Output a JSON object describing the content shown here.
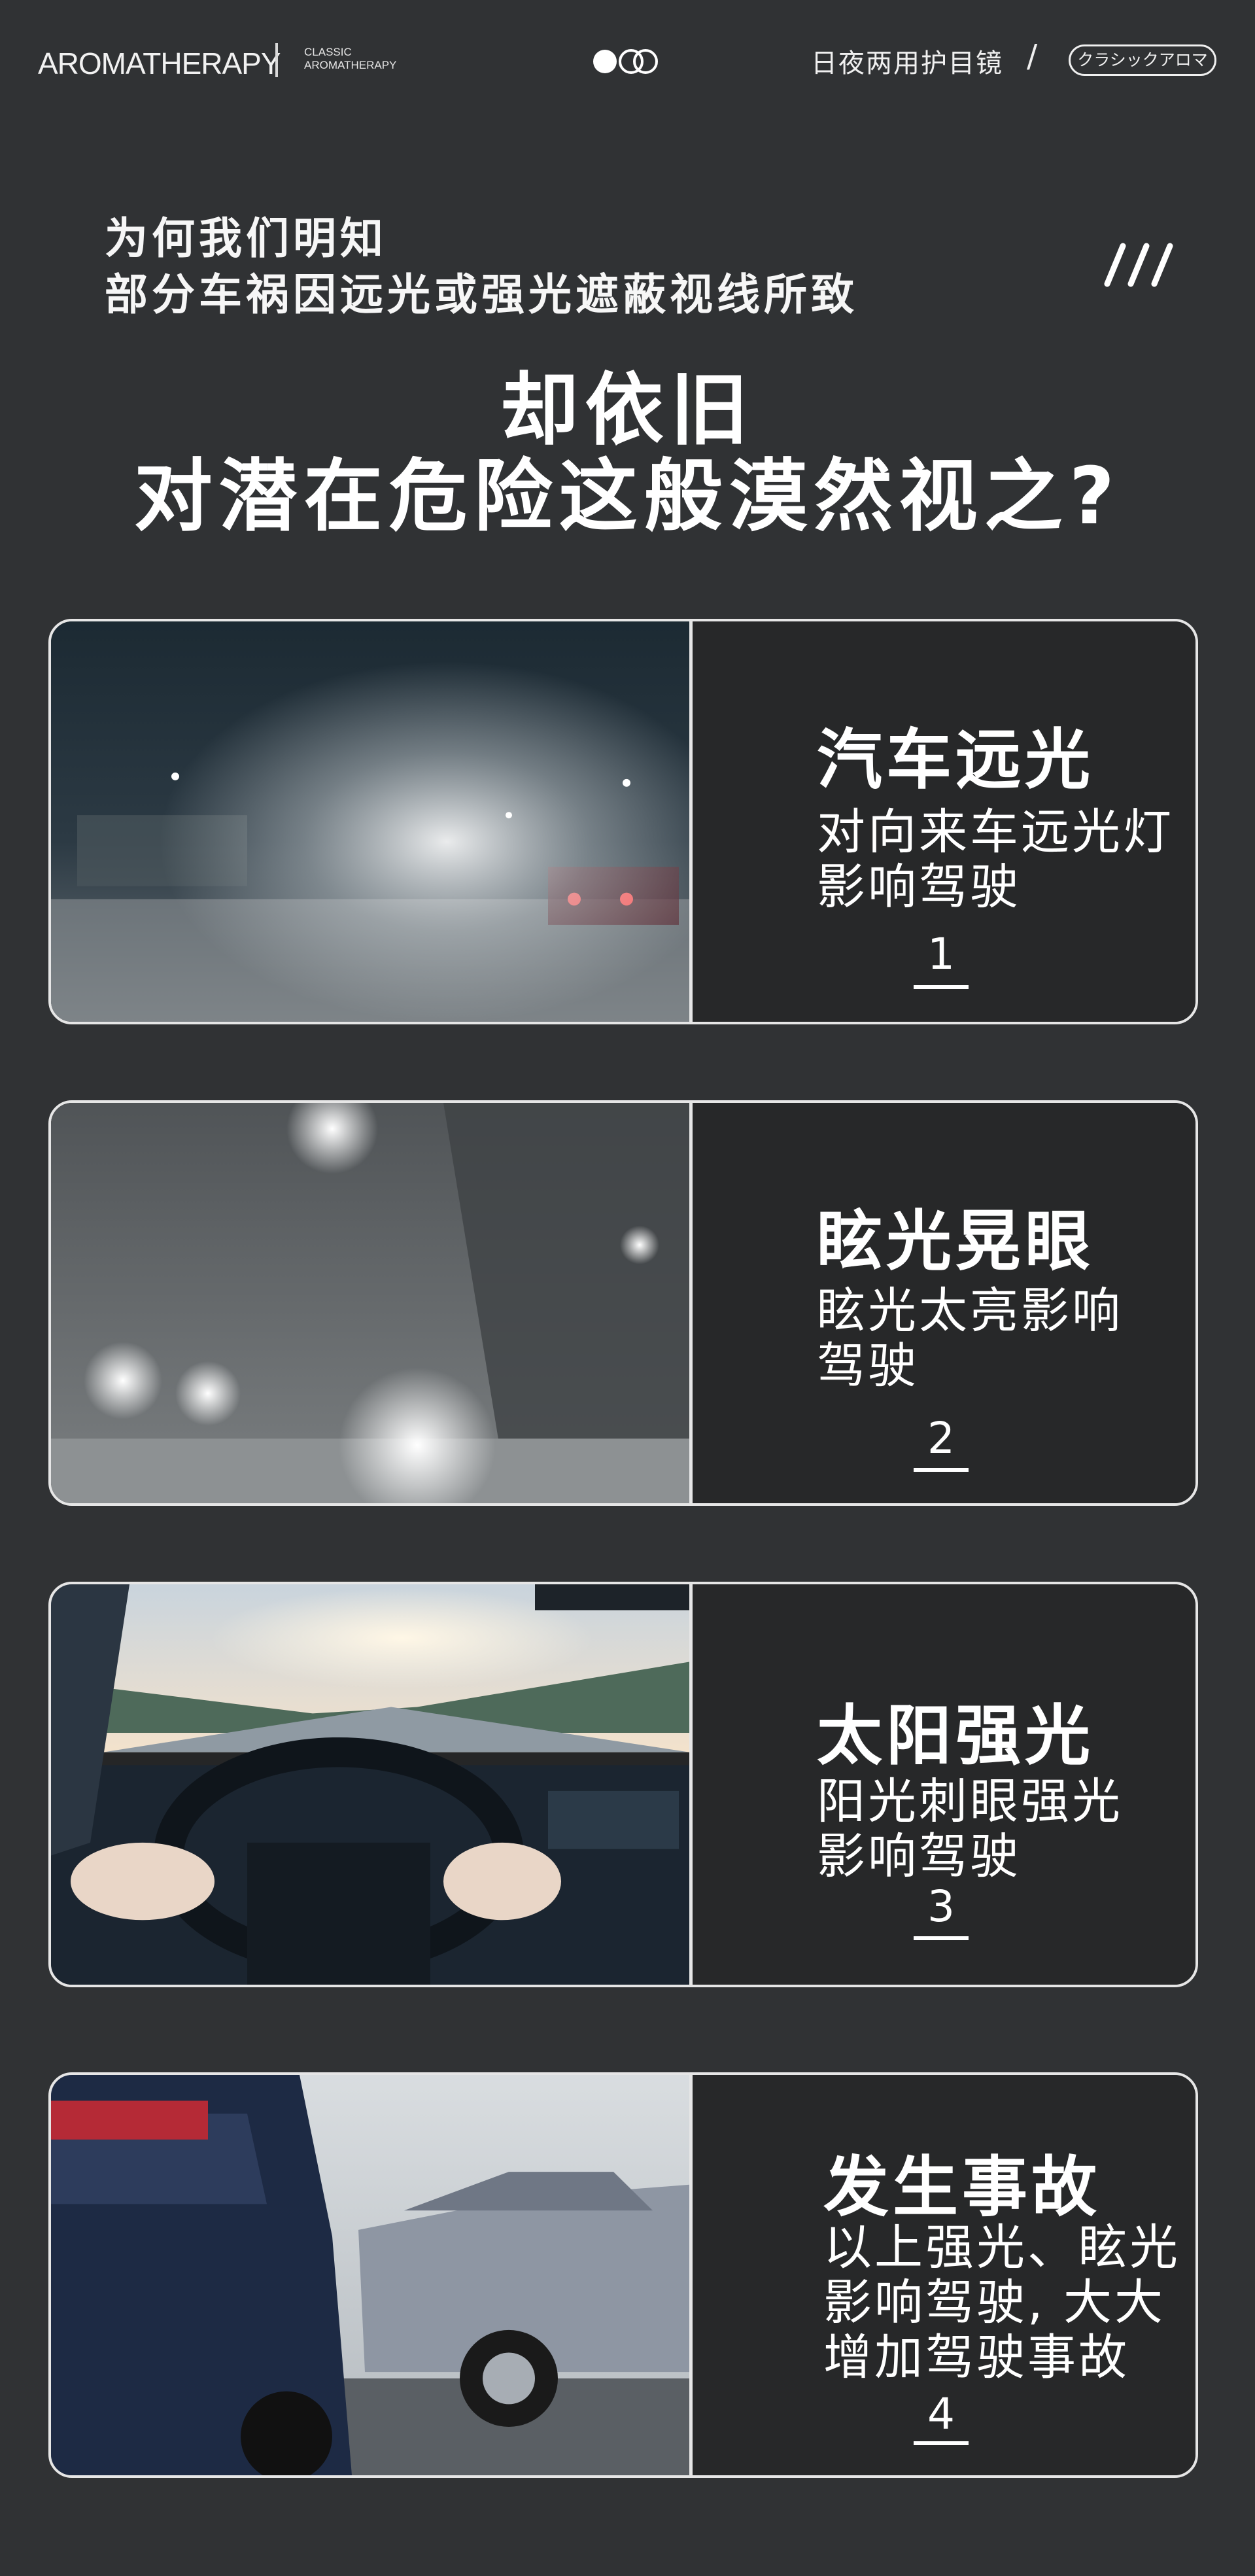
{
  "header": {
    "brand": "AROMATHERAPY",
    "brand_sub_1": "CLASSIC",
    "brand_sub_2": "AROMATHERAPY",
    "nav_text": "日夜两用护目镜",
    "nav_slash": "/",
    "nav_pill": "クラシックアロマ"
  },
  "intro": {
    "line1": "为何我们明知",
    "line2": "部分车祸因远光或强光遮蔽视线所致",
    "slashes": "///"
  },
  "headline": {
    "line1": "却依旧",
    "line2": "对潜在危险这般漠然视之?"
  },
  "cards": [
    {
      "title": "汽车远光",
      "desc1": "对向来车远光灯",
      "desc2": "影响驾驶",
      "desc3": "",
      "number": "1",
      "photo": "night-road-headlight-glare"
    },
    {
      "title": "眩光晃眼",
      "desc1": "眩光太亮影响",
      "desc2": "驾驶",
      "desc3": "",
      "number": "2",
      "photo": "rainy-night-glare"
    },
    {
      "title": "太阳强光",
      "desc1": "阳光刺眼强光",
      "desc2": "影响驾驶",
      "desc3": "",
      "number": "3",
      "photo": "steering-wheel-sun"
    },
    {
      "title": "发生事故",
      "desc1": "以上强光、眩光",
      "desc2": "影响驾驶, 大大",
      "desc3": "增加驾驶事故",
      "number": "4",
      "photo": "car-crash"
    }
  ],
  "colors": {
    "background": "#303234",
    "card_border": "#e6e6e6",
    "text": "#ffffff"
  }
}
